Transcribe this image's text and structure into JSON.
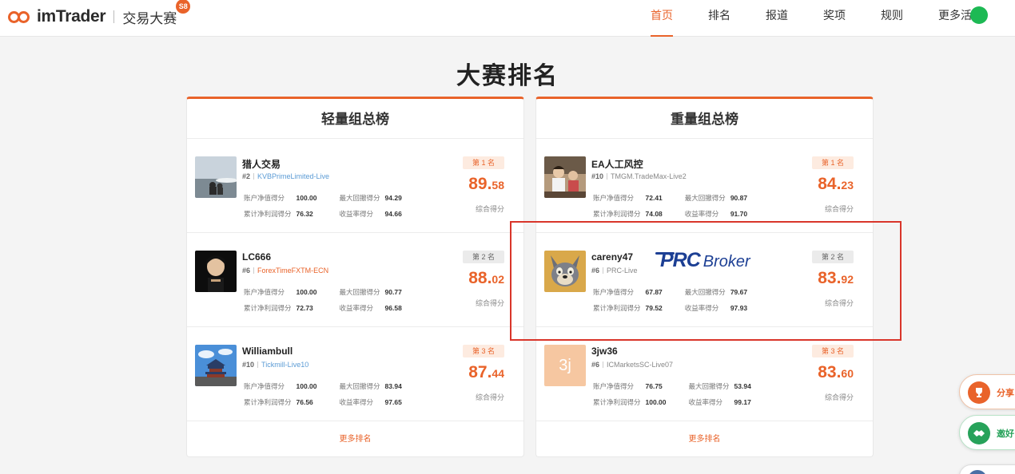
{
  "header": {
    "brand": "imTrader",
    "subtitle": "交易大赛",
    "badge": "S8",
    "nav": [
      {
        "label": "首页",
        "active": true
      },
      {
        "label": "排名",
        "active": false
      },
      {
        "label": "报道",
        "active": false
      },
      {
        "label": "奖项",
        "active": false
      },
      {
        "label": "规则",
        "active": false
      },
      {
        "label": "更多活动",
        "active": false
      }
    ]
  },
  "page_title": "大赛排名",
  "stat_labels": {
    "equity": "账户净值得分",
    "drawdown": "最大回撤得分",
    "profit": "累计净利润得分",
    "return": "收益率得分"
  },
  "score_label": "综合得分",
  "boards": {
    "light": {
      "title": "轻量组总榜",
      "more": "更多排名",
      "entries": [
        {
          "name": "猎人交易",
          "rank_no": "#2",
          "account": "KVBPrimeLimited-Live",
          "rank_label": "第 1 名",
          "score_int": "89.",
          "score_dec": "58",
          "equity": "100.00",
          "drawdown": "94.29",
          "profit": "76.32",
          "return": "94.66"
        },
        {
          "name": "LC666",
          "rank_no": "#6",
          "account": "ForexTimeFXTM-ECN",
          "rank_label": "第 2 名",
          "score_int": "88.",
          "score_dec": "02",
          "equity": "100.00",
          "drawdown": "90.77",
          "profit": "72.73",
          "return": "96.58"
        },
        {
          "name": "Williambull",
          "rank_no": "#10",
          "account": "Tickmill-Live10",
          "rank_label": "第 3 名",
          "score_int": "87.",
          "score_dec": "44",
          "equity": "100.00",
          "drawdown": "83.94",
          "profit": "76.56",
          "return": "97.65"
        }
      ]
    },
    "heavy": {
      "title": "重量组总榜",
      "more": "更多排名",
      "entries": [
        {
          "name": "EA人工风控",
          "rank_no": "#10",
          "account": "TMGM.TradeMax-Live2",
          "rank_label": "第 1 名",
          "score_int": "84.",
          "score_dec": "23",
          "equity": "72.41",
          "drawdown": "90.87",
          "profit": "74.08",
          "return": "91.70"
        },
        {
          "name": "careny47",
          "rank_no": "#6",
          "account": "PRC-Live",
          "rank_label": "第 2 名",
          "score_int": "83.",
          "score_dec": "92",
          "equity": "67.87",
          "drawdown": "79.67",
          "profit": "79.52",
          "return": "97.93",
          "broker_logo_a": "PRC",
          "broker_logo_b": "Broker"
        },
        {
          "name": "3jw36",
          "rank_no": "#6",
          "account": "ICMarketsSC-Live07",
          "rank_label": "第 3 名",
          "score_int": "83.",
          "score_dec": "60",
          "equity": "76.75",
          "drawdown": "53.94",
          "profit": "100.00",
          "return": "99.17",
          "avatar_letter": "3j"
        }
      ]
    }
  },
  "floating": {
    "share": "分享",
    "invite": "邀好"
  },
  "colors": {
    "accent": "#e9632a",
    "highlight": "#d9352a",
    "link": "#5b9bd5",
    "broker": "#1c3f94"
  }
}
